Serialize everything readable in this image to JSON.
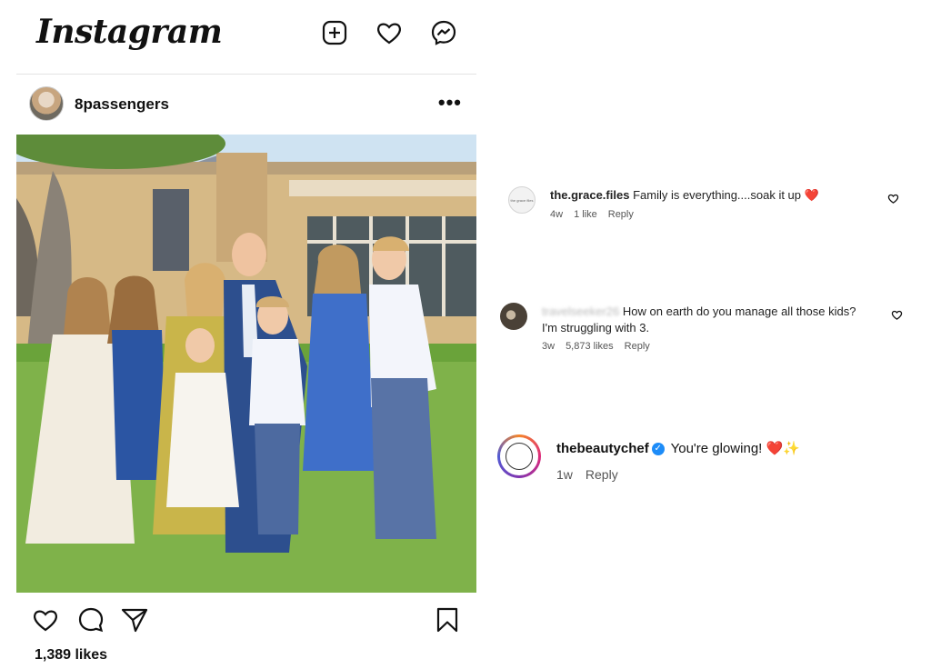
{
  "app": {
    "logo_text": "Instagram"
  },
  "post": {
    "username": "8passengers",
    "more_label": "•••",
    "likes": "1,389 likes"
  },
  "comments": [
    {
      "username": "the.grace.files",
      "text": "Family is everything....soak it up",
      "emoji": "❤️",
      "age": "4w",
      "likes": "1 like",
      "reply": "Reply",
      "avatar_text": "the grace files"
    },
    {
      "username": "travelseeker26",
      "text": "How on earth do you manage all those kids?",
      "text_line2": "I'm struggling with 3.",
      "age": "3w",
      "likes": "5,873 likes",
      "reply": "Reply"
    },
    {
      "username": "thebeautychef",
      "verified": "✓",
      "text": "You're glowing!",
      "emoji": "❤️✨",
      "age": "1w",
      "reply": "Reply"
    }
  ],
  "colors": {
    "verified": "#1d8cf8",
    "heart": "#e0191f",
    "divider": "#e3e3e3"
  }
}
